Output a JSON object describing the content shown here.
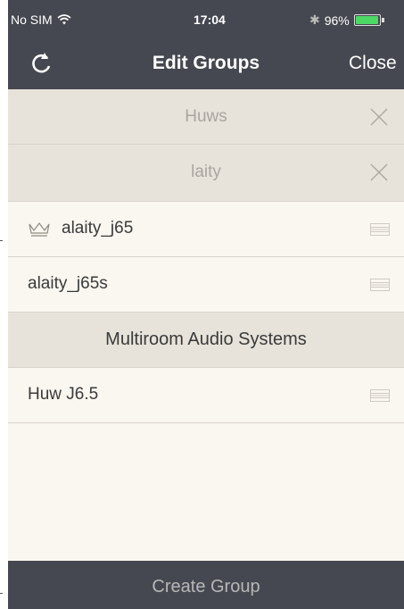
{
  "status_bar": {
    "carrier": "No SIM",
    "time": "17:04",
    "battery": "96%",
    "battery_level": 0.96,
    "icons": [
      "wifi-icon",
      "bluetooth-icon",
      "battery-icon"
    ]
  },
  "nav": {
    "title": "Edit Groups",
    "close_label": "Close",
    "refresh_icon": "refresh-icon"
  },
  "groups": [
    {
      "name": "Huws",
      "remove_icon": "close-x-icon"
    },
    {
      "name": "laity",
      "remove_icon": "close-x-icon"
    }
  ],
  "members": [
    {
      "name": "alaity_j65",
      "is_master": true,
      "handle_icon": "drag-handle-icon"
    },
    {
      "name": "alaity_j65s",
      "is_master": false,
      "handle_icon": "drag-handle-icon"
    }
  ],
  "section": {
    "title": "Multiroom Audio Systems"
  },
  "systems": [
    {
      "name": "Huw J6.5",
      "handle_icon": "drag-handle-icon"
    }
  ],
  "footer": {
    "create_label": "Create Group"
  },
  "colors": {
    "bar": "#454850",
    "group_row": "#e7e3da",
    "list_bg": "#faf7f0",
    "battery_green": "#4cd964"
  }
}
